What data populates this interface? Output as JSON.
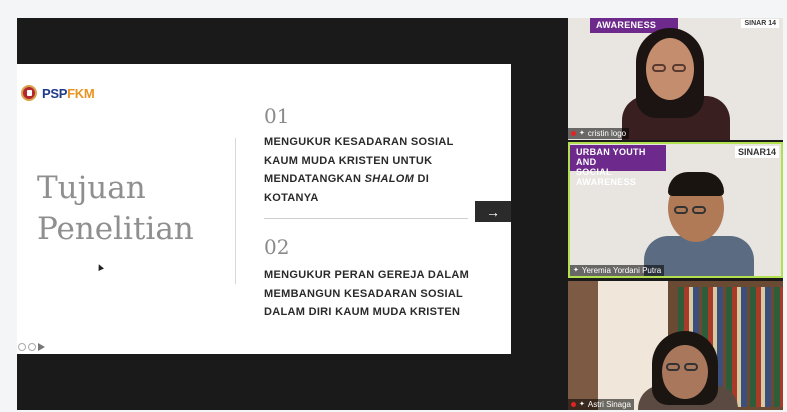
{
  "slide": {
    "logo": {
      "psp": "PSP",
      "fkm": "FKM"
    },
    "title_line1": "Tujuan",
    "title_line2": "Penelitian",
    "item1_num": "01",
    "item1_line1": "MENGUKUR KESADARAN SOSIAL",
    "item1_line2": "KAUM MUDA KRISTEN UNTUK",
    "item1_line3_a": "MENDATANGKAN ",
    "item1_line3_em": "SHALOM",
    "item1_line3_b": " DI",
    "item1_line4": "KOTANYA",
    "item2_num": "02",
    "item2_line1": "MENGUKUR PERAN GEREJA DALAM",
    "item2_line2": "MEMBANGUN KESADARAN SOSIAL",
    "item2_line3": "DALAM DIRI KAUM MUDA KRISTEN",
    "next_arrow": "→"
  },
  "participants": [
    {
      "name": "cristin logo",
      "banner": "AWARENESS",
      "logo": "SINAR 14"
    },
    {
      "name": "Yeremia Yordani Putra",
      "banner_line1": "URBAN YOUTH AND",
      "banner_line2": "SOCIAL AWARENESS",
      "logo": "SINAR14"
    },
    {
      "name": "Astri Sinaga"
    }
  ],
  "colors": {
    "banner": "#6d2a8c",
    "active_speaker": "#b2e051",
    "psp": "#1e3a8a",
    "fkm": "#e89420"
  }
}
